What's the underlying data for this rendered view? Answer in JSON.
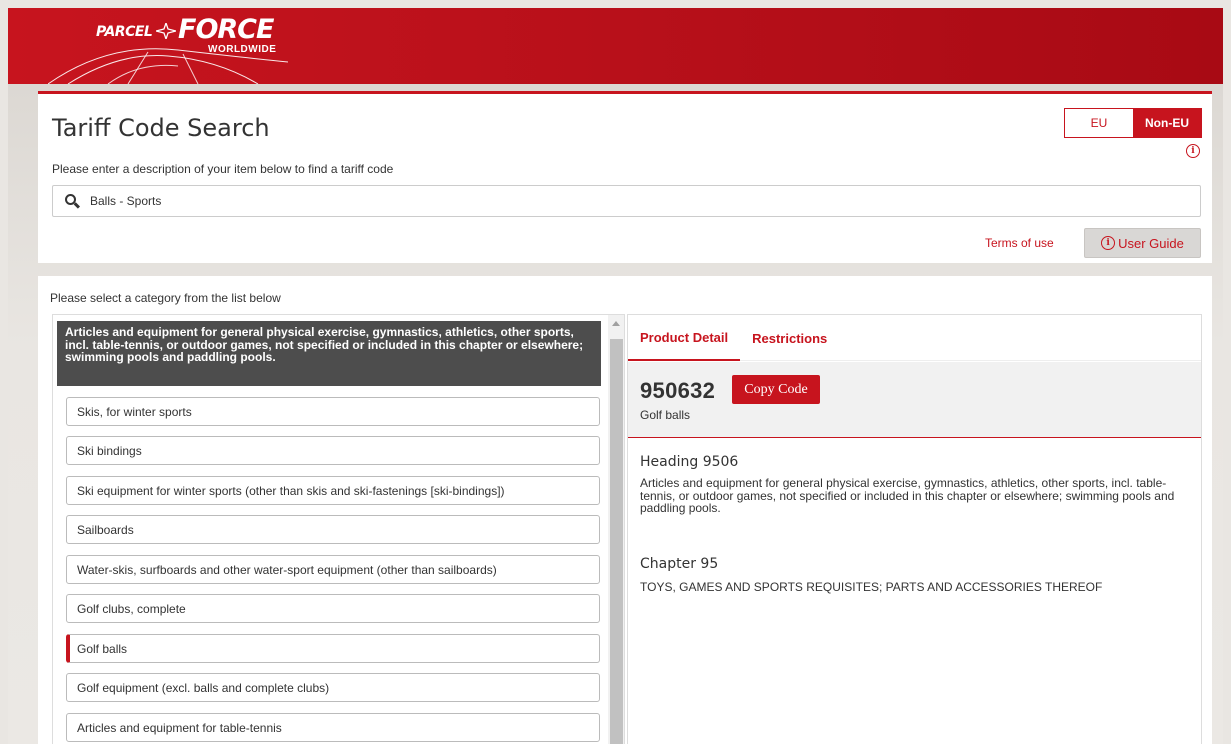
{
  "header": {
    "logo_parcel": "PARCEL",
    "logo_force": "FORCE",
    "logo_worldwide": "WORLDWIDE"
  },
  "search_panel": {
    "title": "Tariff Code Search",
    "toggle": {
      "eu_label": "EU",
      "non_eu_label": "Non-EU",
      "selected": "Non-EU"
    },
    "subtitle": "Please enter a description of your item below to find a tariff code",
    "search_value": "Balls - Sports",
    "terms_label": "Terms of use",
    "guide_label": "User Guide",
    "info_glyph": "i"
  },
  "main": {
    "label": "Please select a category from the list below",
    "category_header": "Articles and equipment for general physical exercise, gymnastics, athletics, other sports, incl. table-tennis, or outdoor games, not specified or included in this chapter or elsewhere; swimming pools and paddling pools.",
    "items": [
      {
        "label": "Skis, for winter sports"
      },
      {
        "label": "Ski bindings"
      },
      {
        "label": "Ski equipment for winter sports (other than skis and ski-fastenings [ski-bindings])"
      },
      {
        "label": "Sailboards"
      },
      {
        "label": "Water-skis, surfboards and other water-sport equipment (other than sailboards)"
      },
      {
        "label": "Golf clubs, complete"
      },
      {
        "label": "Golf balls"
      },
      {
        "label": "Golf equipment (excl. balls and complete clubs)"
      },
      {
        "label": "Articles and equipment for table-tennis"
      }
    ],
    "selected_index": 6
  },
  "detail": {
    "tabs": [
      {
        "label": "Product Detail",
        "active": true
      },
      {
        "label": "Restrictions",
        "active": false
      }
    ],
    "code": "950632",
    "copy_label": "Copy Code",
    "code_description": "Golf balls",
    "heading_title": "Heading 9506",
    "heading_text": "Articles and equipment for general physical exercise, gymnastics, athletics, other sports, incl. table-tennis, or outdoor games, not specified or included in this chapter or elsewhere; swimming pools and paddling pools.",
    "chapter_title": "Chapter 95",
    "chapter_text": "TOYS, GAMES AND SPORTS REQUISITES; PARTS AND ACCESSORIES THEREOF"
  },
  "colors": {
    "brand_red": "#c7141e",
    "header_dark": "#4d4d4d"
  }
}
